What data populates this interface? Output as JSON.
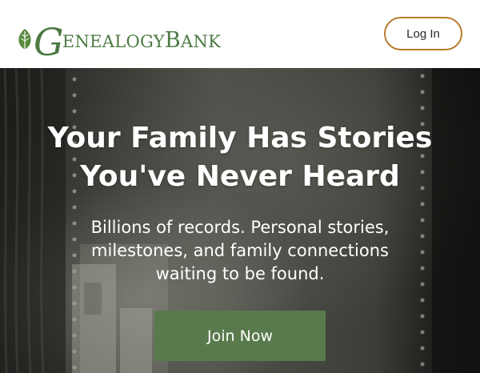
{
  "header": {
    "logo": {
      "initial": "G",
      "part1": "ENEALOGY",
      "initial2": "B",
      "part2": "ANK"
    },
    "login_label": "Log In"
  },
  "hero": {
    "title_line1": "Your Family Has Stories",
    "title_line2": "You've Never Heard",
    "subtitle": "Billions of records. Personal stories, milestones, and family connections waiting to be found.",
    "cta_label": "Join Now"
  },
  "colors": {
    "brand_green": "#4d7a43",
    "cta_green": "#587a4c",
    "login_border": "#b87c2e",
    "hero_text": "#ffffff"
  },
  "icons": {
    "logo_mark": "leaf-icon"
  }
}
